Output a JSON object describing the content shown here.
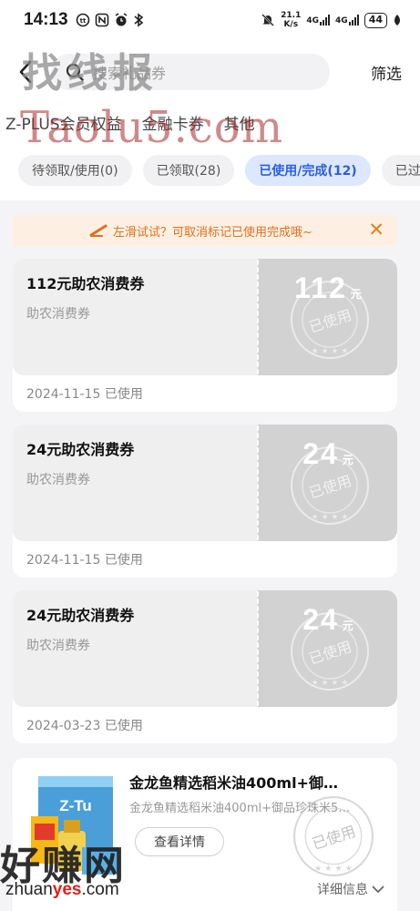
{
  "status_bar": {
    "time": "14:13",
    "net_speed": "21.1",
    "net_unit": "K/s",
    "net1": "4G",
    "net2": "4G",
    "battery": "44"
  },
  "header": {
    "search_placeholder": "搜索礼品券",
    "filter_label": "筛选"
  },
  "category_tabs": [
    "Z-PLUS会员权益",
    "金融卡券",
    "其他"
  ],
  "status_tabs": [
    {
      "label": "待领取/使用(0)",
      "active": false
    },
    {
      "label": "已领取(28)",
      "active": false
    },
    {
      "label": "已使用/完成(12)",
      "active": true
    },
    {
      "label": "已过",
      "active": false
    }
  ],
  "tip": {
    "text": "左滑试试？可取消标记已使用完成哦~"
  },
  "coupons": [
    {
      "title": "112元助农消费券",
      "subtitle": "助农消费券",
      "amount": "112",
      "unit": "元",
      "stamp": "已使用",
      "date": "2024-11-15",
      "status": "已使用"
    },
    {
      "title": "24元助农消费券",
      "subtitle": "助农消费券",
      "amount": "24",
      "unit": "元",
      "stamp": "已使用",
      "date": "2024-11-15",
      "status": "已使用"
    },
    {
      "title": "24元助农消费券",
      "subtitle": "助农消费券",
      "amount": "24",
      "unit": "元",
      "stamp": "已使用",
      "date": "2024-03-23",
      "status": "已使用"
    }
  ],
  "product": {
    "title": "金龙鱼精选稻米油400ml+御…",
    "subtitle": "金龙鱼精选稻米油400ml+御品珍珠米5…",
    "view_label": "查看详情",
    "stamp": "已使用",
    "detail_label": "详细信息",
    "box_brand": "Z-Tu"
  },
  "watermarks": {
    "top_cn": "找线报",
    "top_en": "Taolu5.com",
    "bottom_cn": "好赚网",
    "bottom_url_pre": "zhuan",
    "bottom_url_mid": "yes",
    "bottom_url_post": ".com"
  },
  "colors": {
    "accent": "#2b5fe0",
    "tip": "#e0701e",
    "coupon_used": "#d2d2d2"
  }
}
